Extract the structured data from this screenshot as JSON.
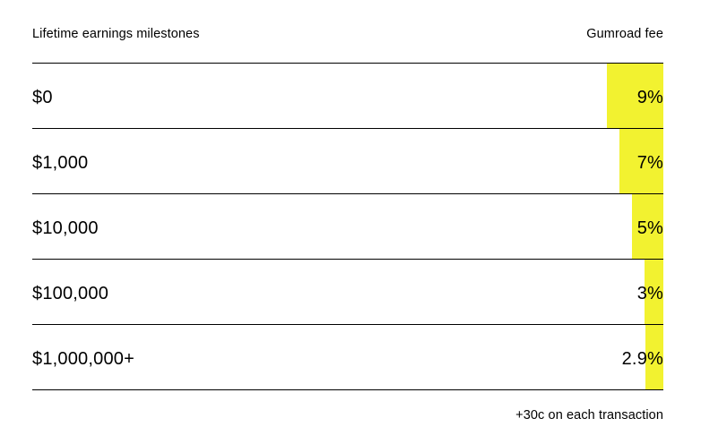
{
  "header": {
    "milestones_label": "Lifetime earnings milestones",
    "fee_label": "Gumroad fee"
  },
  "rows": [
    {
      "milestone": "$0",
      "fee": "9%",
      "fee_value": 9
    },
    {
      "milestone": "$1,000",
      "fee": "7%",
      "fee_value": 7
    },
    {
      "milestone": "$10,000",
      "fee": "5%",
      "fee_value": 5
    },
    {
      "milestone": "$100,000",
      "fee": "3%",
      "fee_value": 3
    },
    {
      "milestone": "$1,000,000+",
      "fee": "2.9%",
      "fee_value": 2.9
    }
  ],
  "footnote": "+30c on each transaction",
  "colors": {
    "bar": "#f2f230",
    "rule": "#000000",
    "text": "#000000"
  }
}
